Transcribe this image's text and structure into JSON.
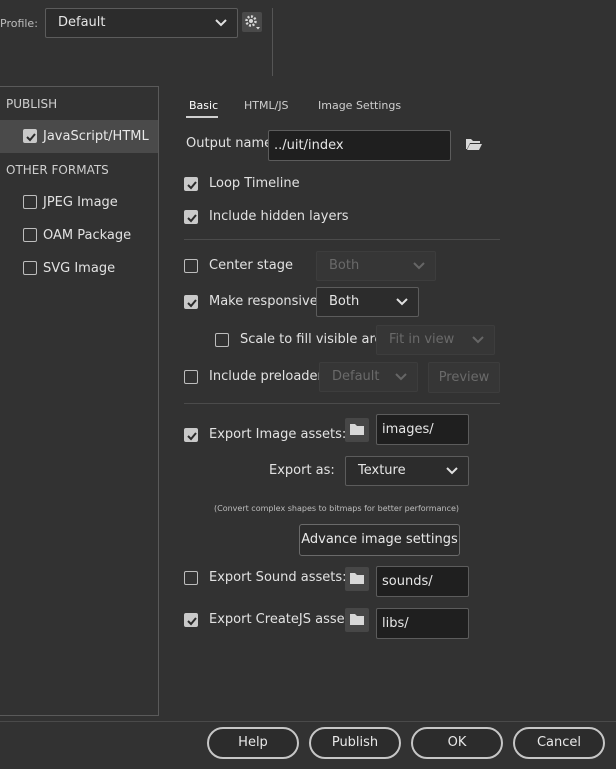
{
  "profile": {
    "label": "Profile:",
    "value": "Default"
  },
  "sidebar": {
    "publish_heading": "PUBLISH",
    "publish_item": "JavaScript/HTML",
    "other_heading": "OTHER FORMATS",
    "other_items": [
      "JPEG Image",
      "OAM Package",
      "SVG Image"
    ]
  },
  "tabs": [
    "Basic",
    "HTML/JS",
    "Image Settings"
  ],
  "form": {
    "output_name_label": "Output name:",
    "output_name_value": "../uit/index",
    "loop_timeline": "Loop Timeline",
    "include_hidden_layers": "Include hidden layers",
    "center_stage": "Center stage",
    "center_stage_value": "Both",
    "make_responsive": "Make responsive",
    "make_responsive_value": "Both",
    "scale_to_fill": "Scale to fill visible area",
    "scale_to_fill_value": "Fit in view",
    "include_preloader": "Include preloader",
    "preloader_value": "Default",
    "preview_button": "Preview",
    "export_image_assets": "Export Image assets:",
    "image_assets_path": "images/",
    "export_as_label": "Export as:",
    "export_as_value": "Texture",
    "export_note": "(Convert complex shapes to bitmaps for better performance)",
    "advance_image_settings": "Advance image settings",
    "export_sound_assets": "Export Sound assets:",
    "sound_assets_path": "sounds/",
    "export_createjs_assets": "Export CreateJS assets:",
    "createjs_assets_path": "libs/"
  },
  "footer": {
    "help": "Help",
    "publish": "Publish",
    "ok": "OK",
    "cancel": "Cancel"
  },
  "icons": {
    "gear": "gear-icon",
    "folder": "folder-icon",
    "chevron": "chevron-down-icon",
    "checkmark": "checkmark-icon"
  }
}
